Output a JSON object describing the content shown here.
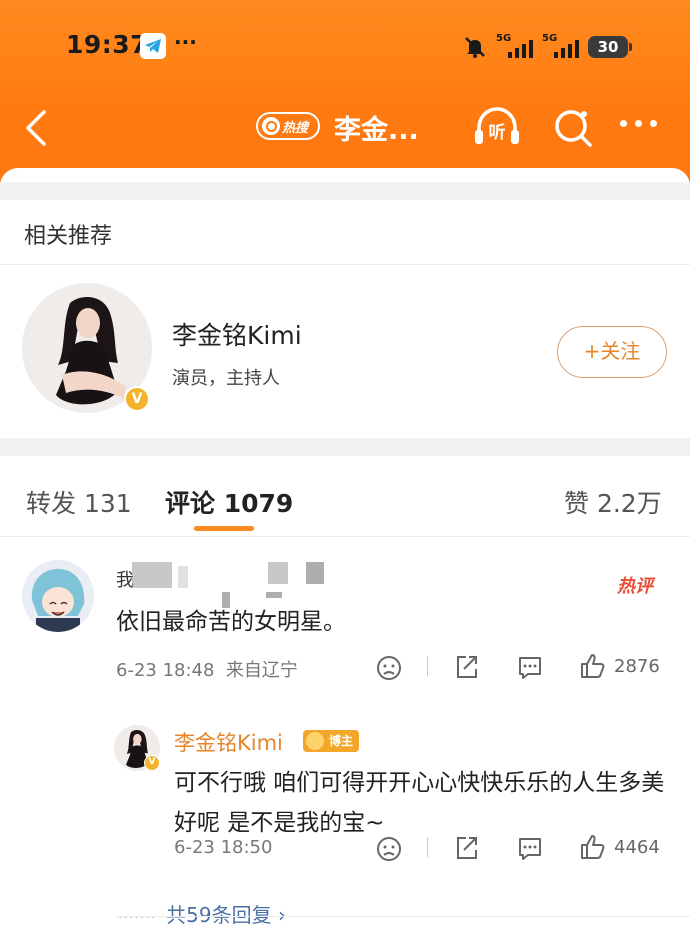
{
  "status_bar": {
    "time": "19:37",
    "more_dots": "···",
    "signal1": "5G",
    "signal2": "5G",
    "battery": "30",
    "icons": [
      "telegram-icon",
      "mute-bell-icon",
      "signal-5g-icon",
      "battery-icon"
    ]
  },
  "nav": {
    "hot_badge": "热搜",
    "title": "李金...",
    "listen_label": "听",
    "icons": [
      "back-icon",
      "listen-icon",
      "search-icon",
      "more-icon"
    ]
  },
  "recommend": {
    "section_title": "相关推荐",
    "user_name": "李金铭Kimi",
    "user_desc": "演员，主持人",
    "verified_mark": "V",
    "follow_label": "+关注"
  },
  "tabs": {
    "repost": "转发 131",
    "comment": "评论 1079",
    "likes": "赞 2.2万"
  },
  "comment": {
    "username": "我",
    "hot_label": "热评",
    "text": "依旧最命苦的女明星。",
    "time": "6-23 18:48",
    "location": "来自辽宁",
    "like_count": "2876"
  },
  "reply": {
    "username": "李金铭Kimi",
    "badge": "博主",
    "text": "可不行哦 咱们可得开开心心快快乐乐的人生多美好呢 是不是我的宝~",
    "time": "6-23 18:50",
    "like_count": "4464",
    "leader": "·······",
    "more_replies": "共59条回复 ›"
  },
  "colors": {
    "brand_orange": "#ff7a10",
    "accent_orange": "#e8852a",
    "hot_red": "#e8503a",
    "link_blue": "#4a6fa5"
  }
}
